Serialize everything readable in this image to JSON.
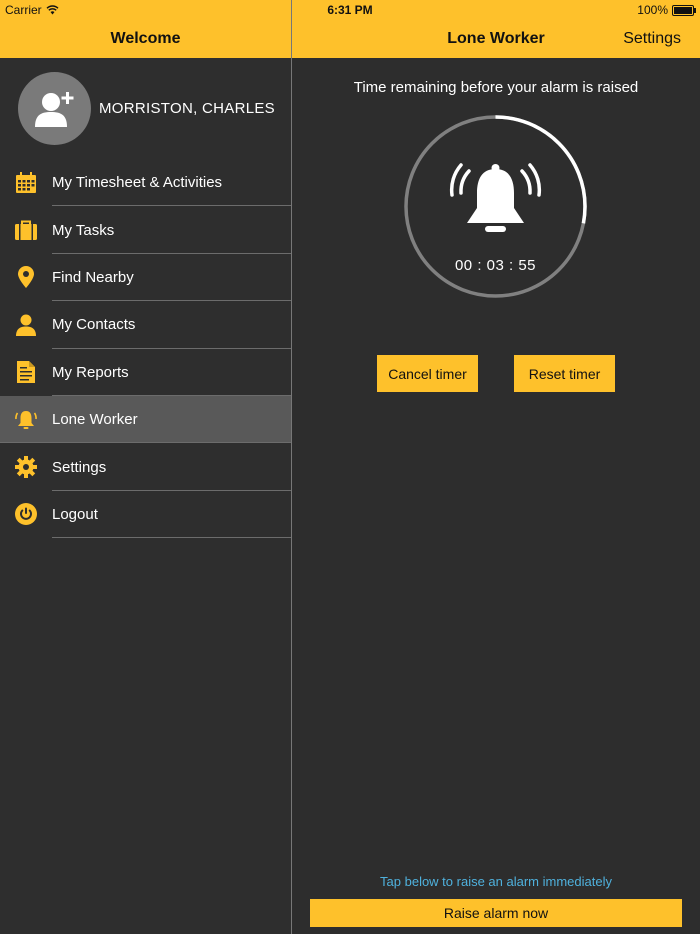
{
  "status_bar": {
    "carrier": "Carrier",
    "time": "6:31 PM",
    "battery": "100%"
  },
  "sidebar": {
    "title": "Welcome",
    "user_name": "MORRISTON, CHARLES",
    "items": [
      {
        "label": "My Timesheet & Activities",
        "icon": "calendar-icon"
      },
      {
        "label": "My Tasks",
        "icon": "briefcase-icon"
      },
      {
        "label": "Find Nearby",
        "icon": "location-pin-icon"
      },
      {
        "label": "My Contacts",
        "icon": "person-icon"
      },
      {
        "label": "My Reports",
        "icon": "document-icon"
      },
      {
        "label": "Lone Worker",
        "icon": "alarm-bell-icon",
        "active": true
      },
      {
        "label": "Settings",
        "icon": "gear-icon"
      },
      {
        "label": "Logout",
        "icon": "power-icon"
      }
    ]
  },
  "header": {
    "title": "Lone Worker",
    "settings_label": "Settings"
  },
  "main": {
    "prompt": "Time remaining before your alarm is raised",
    "countdown": "00 : 03 : 55",
    "timer_progress": 0.28,
    "cancel_label": "Cancel timer",
    "reset_label": "Reset timer",
    "hint": "Tap below to raise an alarm immediately",
    "raise_label": "Raise alarm now"
  },
  "colors": {
    "accent": "#fec12b",
    "background": "#2d2d2d",
    "hint": "#4fb1dd"
  }
}
